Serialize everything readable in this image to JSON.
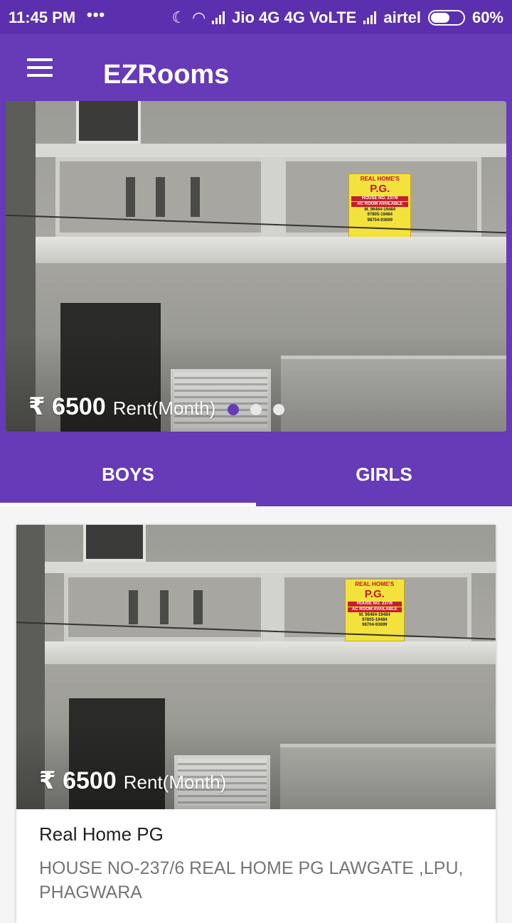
{
  "status_bar": {
    "time": "11:45 PM",
    "dots": "•••",
    "carrier1": "Jio 4G 4G VoLTE",
    "carrier2": "airtel",
    "battery": "60%",
    "battery_level": 0.6
  },
  "app_bar": {
    "title": "EZRooms",
    "menu_icon": "hamburger-menu-icon"
  },
  "carousel": {
    "price": "₹ 6500",
    "price_unit": "Rent(Month)",
    "slide_count": 3,
    "active_slide": 0
  },
  "tabs": [
    {
      "label": "BOYS",
      "active": true
    },
    {
      "label": "GIRLS",
      "active": false
    }
  ],
  "listings": [
    {
      "price": "₹ 6500",
      "price_unit": "Rent(Month)",
      "title": "Real Home PG",
      "address": "HOUSE NO-237/6 REAL HOME PG LAWGATE ,LPU, PHAGWARA"
    }
  ],
  "sign": {
    "line1": "REAL HOME'S",
    "line2": "P.G.",
    "line3": "HOUSE NO. 237/6",
    "line4": "AC ROOM AVAILABLE",
    "line5": "M. 96464-19484",
    "line6": "97805-19484",
    "line7": "98704-93699"
  },
  "colors": {
    "primary": "#673ab7",
    "status_bar": "#5c2fae",
    "indicator_active": "#673ab7"
  }
}
